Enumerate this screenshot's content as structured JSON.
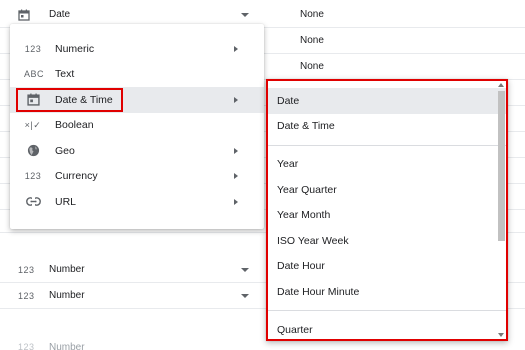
{
  "background_rows": [
    {
      "icon": "calendar-icon",
      "name": "Date",
      "value": "None"
    },
    {
      "value": "None"
    },
    {
      "value": "None"
    }
  ],
  "lower_rows": [
    {
      "icon_text": "123",
      "name": "Number"
    },
    {
      "icon_text": "123",
      "name": "Number"
    },
    {
      "icon_text": "123",
      "name": "Number"
    }
  ],
  "type_menu": {
    "items": [
      {
        "icon_text": "123",
        "label": "Numeric",
        "has_submenu": true
      },
      {
        "icon_text": "ABC",
        "label": "Text",
        "has_submenu": false
      },
      {
        "icon": "calendar-icon",
        "label": "Date & Time",
        "has_submenu": true,
        "active": true
      },
      {
        "icon_text": "×|✓",
        "label": "Boolean",
        "has_submenu": false
      },
      {
        "icon": "globe-icon",
        "label": "Geo",
        "has_submenu": true
      },
      {
        "icon_text": "123",
        "label": "Currency",
        "has_submenu": true
      },
      {
        "icon": "link-icon",
        "label": "URL",
        "has_submenu": true
      }
    ]
  },
  "date_submenu": {
    "group1": [
      "Date",
      "Date & Time"
    ],
    "group2": [
      "Year",
      "Year Quarter",
      "Year Month",
      "ISO Year Week",
      "Date Hour",
      "Date Hour Minute"
    ],
    "group3": [
      "Quarter"
    ],
    "selected": "Date"
  },
  "colors": {
    "highlight_border": "#e00000",
    "active_bg": "#e8eaed",
    "icon_gray": "#5f6368"
  }
}
